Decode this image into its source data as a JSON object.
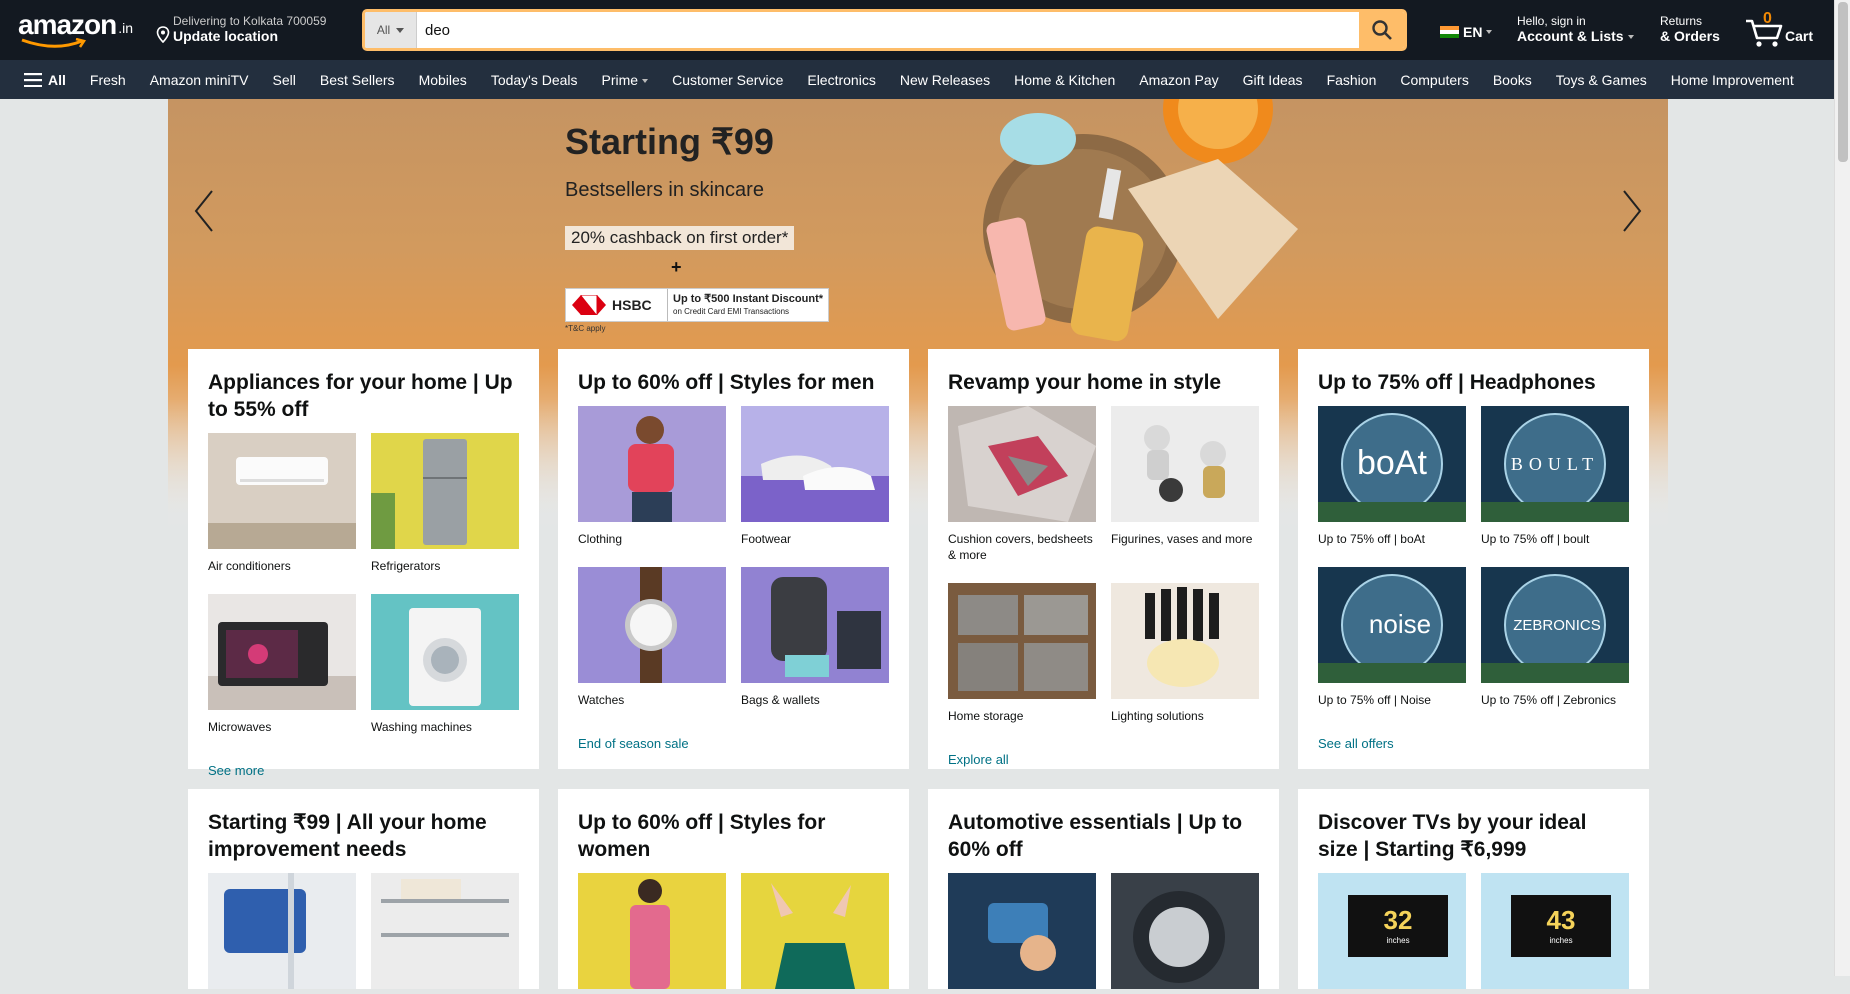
{
  "header": {
    "logo_text": "amazon",
    "logo_tld": ".in",
    "deliver_line1": "Delivering to Kolkata 700059",
    "deliver_line2": "Update location",
    "search_category": "All",
    "search_value": "deo",
    "language": "EN",
    "account_line1": "Hello, sign in",
    "account_line2": "Account & Lists",
    "returns_line1": "Returns",
    "returns_line2": "& Orders",
    "cart_count": "0",
    "cart_label": "Cart"
  },
  "subnav": {
    "all_label": "All",
    "items": [
      "Fresh",
      "Amazon miniTV",
      "Sell",
      "Best Sellers",
      "Mobiles",
      "Today's Deals",
      "Prime",
      "Customer Service",
      "Electronics",
      "New Releases",
      "Home & Kitchen",
      "Amazon Pay",
      "Gift Ideas",
      "Fashion",
      "Computers",
      "Books",
      "Toys & Games",
      "Home Improvement"
    ]
  },
  "hero": {
    "headline": "Starting ₹99",
    "subhead": "Bestsellers in skincare",
    "cashback": "20% cashback on first order*",
    "plus": "+",
    "bank": "HSBC",
    "bank_offer_line1": "Up to ₹500 Instant Discount*",
    "bank_offer_line2": "on Credit Card EMI Transactions",
    "tc": "*T&C apply"
  },
  "cards": [
    {
      "title": "Appliances for your home | Up to 55% off",
      "tiles": [
        "Air conditioners",
        "Refrigerators",
        "Microwaves",
        "Washing machines"
      ],
      "link": "See more"
    },
    {
      "title": "Up to 60% off | Styles for men",
      "tiles": [
        "Clothing",
        "Footwear",
        "Watches",
        "Bags & wallets"
      ],
      "link": "End of season sale"
    },
    {
      "title": "Revamp your home in style",
      "tiles": [
        "Cushion covers, bedsheets & more",
        "Figurines, vases and more",
        "Home storage",
        "Lighting solutions"
      ],
      "link": "Explore all"
    },
    {
      "title": "Up to 75% off | Headphones",
      "tiles": [
        "Up to 75% off | boAt",
        "Up to 75% off | boult",
        "Up to 75% off | Noise",
        "Up to 75% off | Zebronics"
      ],
      "link": "See all offers"
    },
    {
      "title": "Starting ₹99 | All your home improvement needs"
    },
    {
      "title": "Up to 60% off | Styles for women"
    },
    {
      "title": "Automotive essentials | Up to 60% off"
    },
    {
      "title": "Discover TVs by your ideal size | Starting ₹6,999"
    }
  ],
  "tile_brand_text": {
    "boat": "boAt",
    "boult": "BOULT",
    "noise": "noise",
    "zebronics": "ZEBRONICS",
    "tv32": "32",
    "tv43": "43",
    "inches": "inches"
  },
  "colors": {
    "nav_top": "#131921",
    "nav_sub": "#232f3e",
    "search_btn": "#febd69",
    "link": "#007185",
    "cart_count": "#f08804"
  }
}
